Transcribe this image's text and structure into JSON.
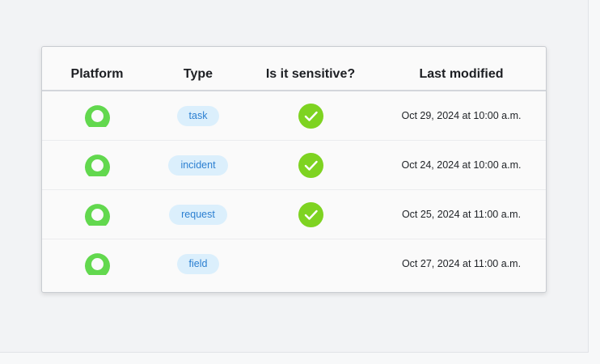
{
  "table": {
    "headers": {
      "platform": "Platform",
      "type": "Type",
      "sensitive": "Is it sensitive?",
      "last_modified": "Last modified"
    },
    "rows": [
      {
        "platform_icon": "green-ring-platform-icon",
        "type": "task",
        "sensitive": true,
        "last_modified": "Oct 29, 2024 at 10:00 a.m."
      },
      {
        "platform_icon": "green-ring-platform-icon",
        "type": "incident",
        "sensitive": true,
        "last_modified": "Oct 24, 2024 at 10:00 a.m."
      },
      {
        "platform_icon": "green-ring-platform-icon",
        "type": "request",
        "sensitive": true,
        "last_modified": "Oct 25, 2024 at 11:00 a.m."
      },
      {
        "platform_icon": "green-ring-platform-icon",
        "type": "field",
        "sensitive": false,
        "last_modified": "Oct 27, 2024 at 11:00 a.m."
      }
    ]
  },
  "colors": {
    "platform_green": "#62d84e",
    "check_green": "#7ed321",
    "pill_bg": "#dbeffc",
    "pill_text": "#2b7fd1"
  }
}
